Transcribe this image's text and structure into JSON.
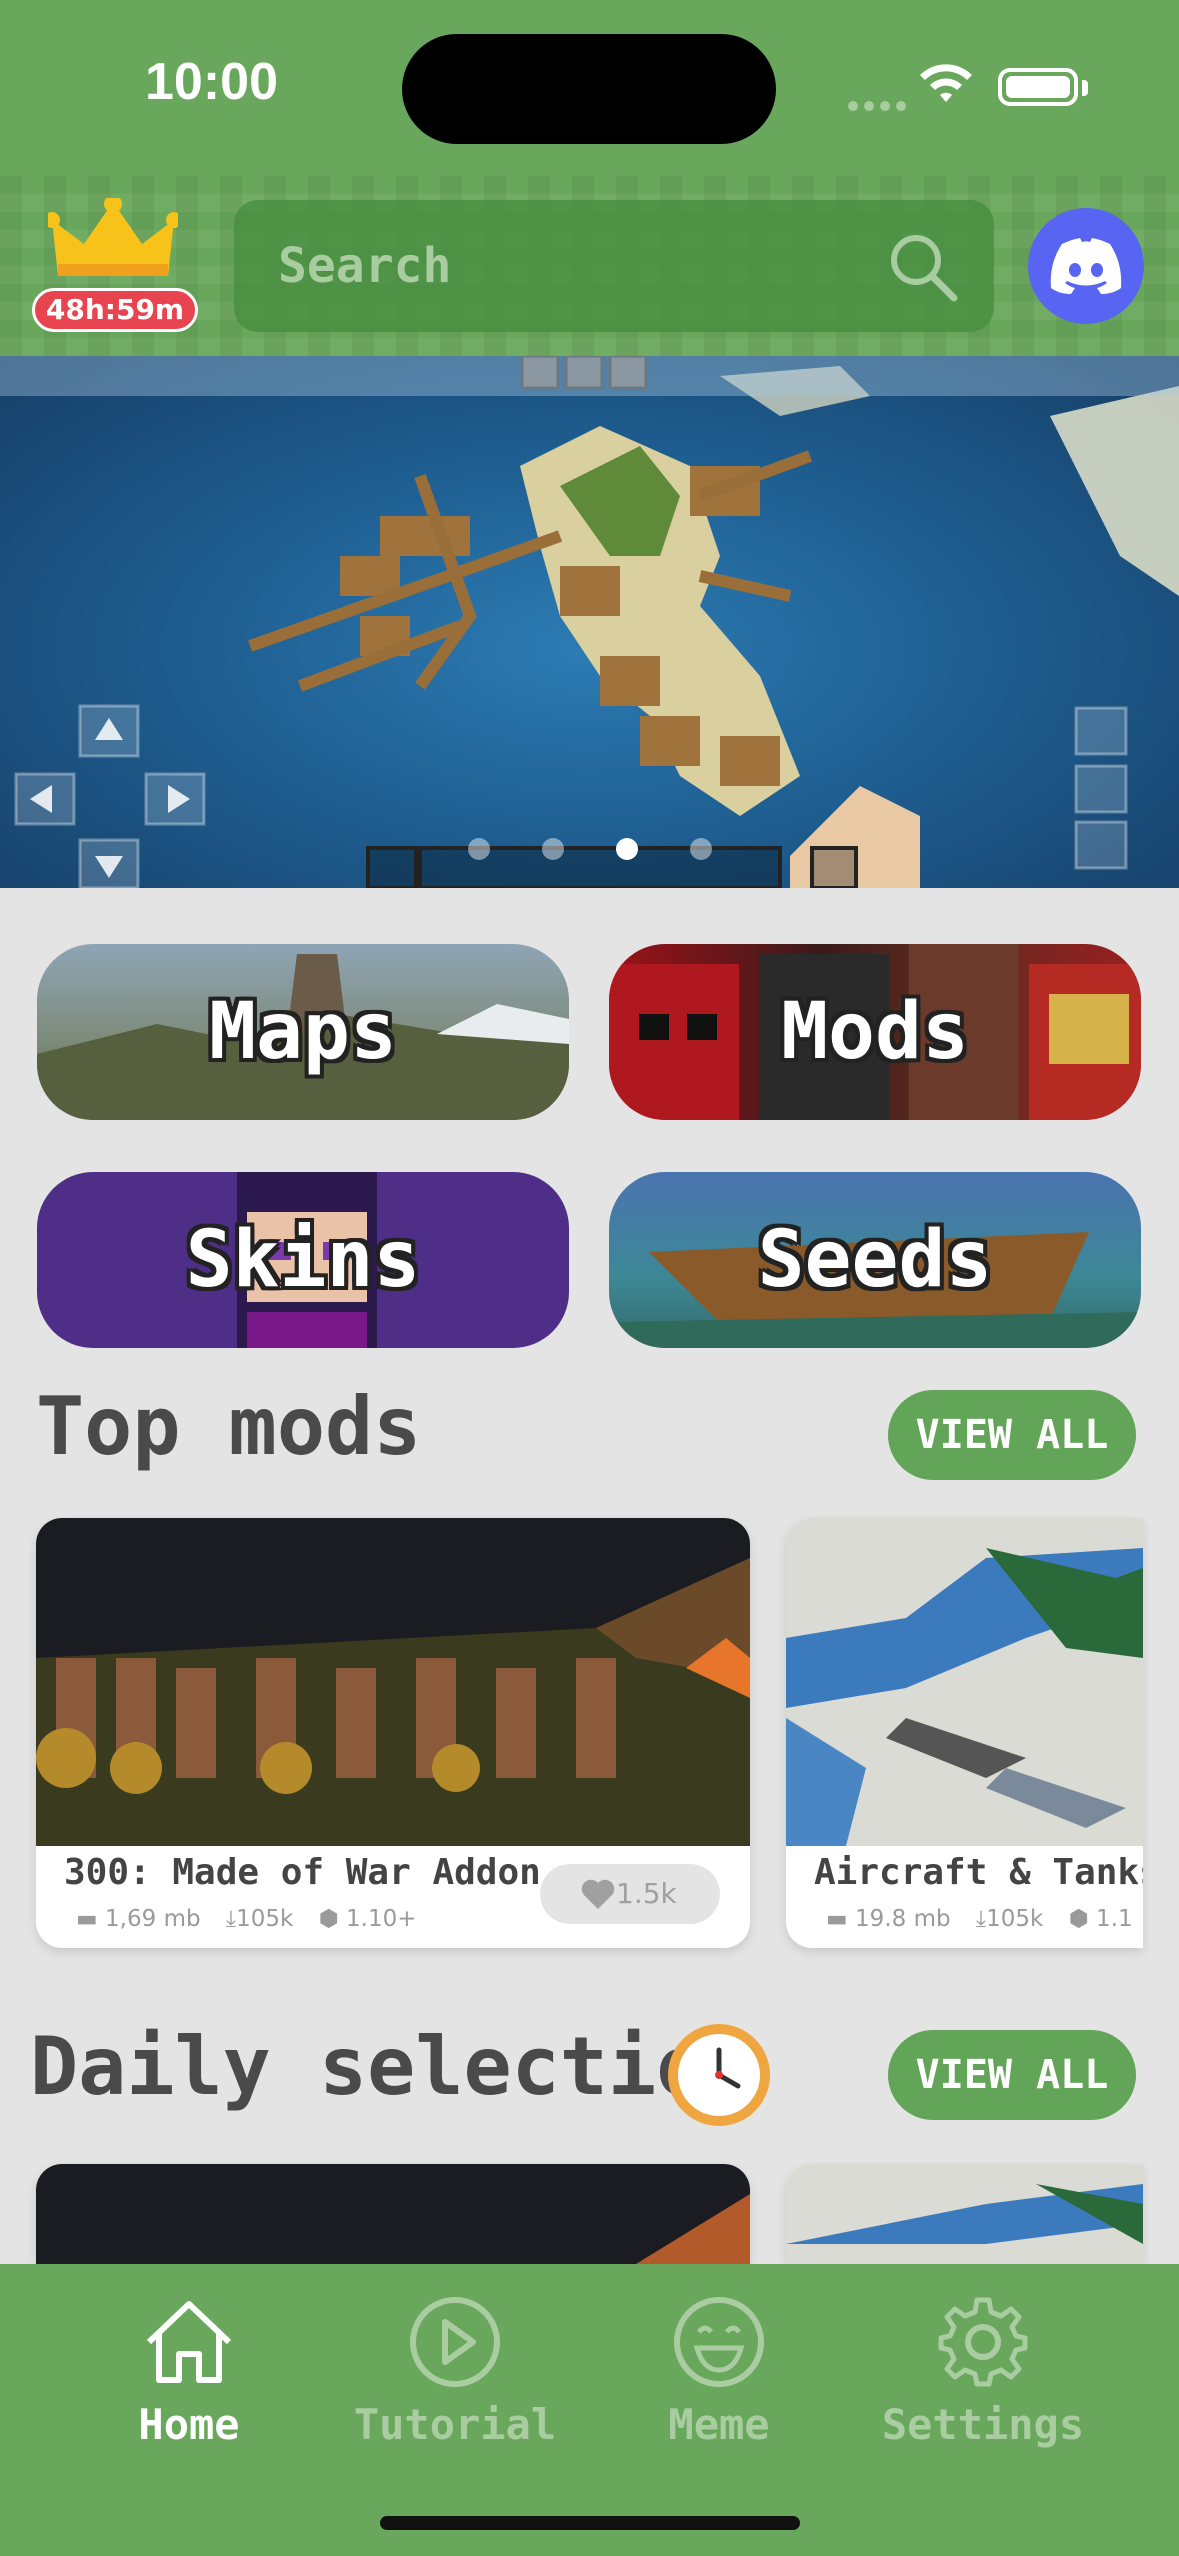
{
  "status": {
    "time": "10:00"
  },
  "header": {
    "timer": "48h:59m",
    "search_placeholder": "Search"
  },
  "banner": {
    "slide_count": 4,
    "active_slide": 3
  },
  "categories": [
    {
      "id": "maps",
      "label": "Maps"
    },
    {
      "id": "mods",
      "label": "Mods"
    },
    {
      "id": "skins",
      "label": "Skins"
    },
    {
      "id": "seeds",
      "label": "Seeds"
    }
  ],
  "top_mods": {
    "title": "Top mods",
    "view_all": "VIEW ALL",
    "items": [
      {
        "title": "300: Made of War Addon",
        "size": "1,69 mb",
        "downloads": "105k",
        "version": "1.10+",
        "likes": "1.5k"
      },
      {
        "title": "Aircraft & Tanks",
        "size": "19.8 mb",
        "downloads": "105k",
        "version": "1.1"
      }
    ]
  },
  "daily_selection": {
    "title": "Daily selection",
    "view_all": "VIEW ALL"
  },
  "tabs": [
    {
      "id": "home",
      "label": "Home",
      "icon": "home-icon",
      "active": true
    },
    {
      "id": "tutorial",
      "label": "Tutorial",
      "icon": "play-icon",
      "active": false
    },
    {
      "id": "meme",
      "label": "Meme",
      "icon": "smile-icon",
      "active": false
    },
    {
      "id": "settings",
      "label": "Settings",
      "icon": "gear-icon",
      "active": false
    }
  ],
  "colors": {
    "primary": "#69a85c",
    "button": "#62a458",
    "badge": "#e8444f",
    "background": "#e4e4e4"
  }
}
